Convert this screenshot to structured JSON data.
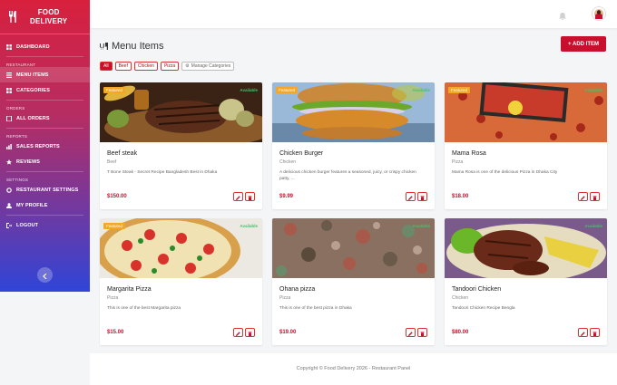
{
  "brand": {
    "line1": "FOOD",
    "line2": "DELIVERY"
  },
  "sidebar": {
    "dashboard": "DASHBOARD",
    "section_restaurant": "RESTAURANT",
    "menu_items": "MENU ITEMS",
    "categories": "CATEGORIES",
    "section_orders": "ORDERS",
    "all_orders": "ALL ORDERS",
    "section_reports": "REPORTS",
    "sales_reports": "SALES REPORTS",
    "reviews": "REVIEWS",
    "section_settings": "SETTINGS",
    "restaurant_settings": "RESTAURANT SETTINGS",
    "my_profile": "MY PROFILE",
    "logout": "LOGOUT"
  },
  "page": {
    "title": "Menu Items",
    "add_button": "+ ADD ITEM"
  },
  "filters": {
    "all": "All",
    "beef": "Beef",
    "chicken": "Chicken",
    "pizza": "Pizza",
    "manage": "Manage Categories"
  },
  "labels": {
    "featured": "Featured",
    "available": "Available"
  },
  "items": [
    {
      "name": "Beef steak",
      "category": "Beef",
      "description": "T Bone Steak - Secret Recipe Bangladesh Best in Dhaka",
      "price": "$150.00",
      "featured": true,
      "available": true
    },
    {
      "name": "Chicken Burger",
      "category": "Chicken",
      "description": "A delicious chicken burger features a seasoned, juicy, or crispy chicken patty, ...",
      "price": "$9.99",
      "featured": true,
      "available": true
    },
    {
      "name": "Mama Rosa",
      "category": "Pizza",
      "description": "Mama Rosa is one of the delicious Pizza in Dhaka City",
      "price": "$18.00",
      "featured": true,
      "available": true
    },
    {
      "name": "Margarita Pizza",
      "category": "Pizza",
      "description": "This is one of the best Margarita pizza",
      "price": "$15.00",
      "featured": true,
      "available": true
    },
    {
      "name": "Ohana pizza",
      "category": "Pizza",
      "description": "This is one of the best pizza in Dhaka",
      "price": "$19.00",
      "featured": false,
      "available": true
    },
    {
      "name": "Tandoori Chicken",
      "category": "Chicken",
      "description": "Tandoori Chicken Recipe Bengla",
      "price": "$80.00",
      "featured": false,
      "available": true
    }
  ],
  "footer": "Copyright © Food Delivery 2026 - Restaurant Panel",
  "colors": {
    "accent": "#c8102e",
    "available": "#3ec46d",
    "featured": "#f5a623"
  }
}
